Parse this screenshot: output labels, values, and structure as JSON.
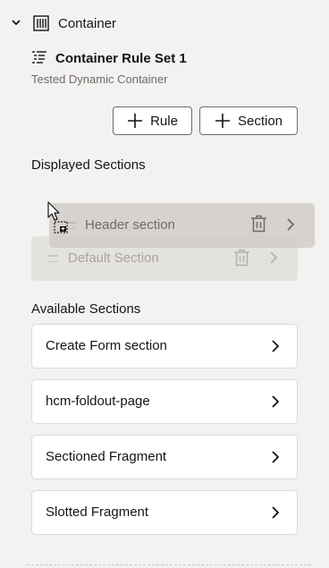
{
  "container": {
    "title": "Container"
  },
  "rule_set": {
    "title": "Container Rule Set 1",
    "subtitle": "Tested Dynamic Container"
  },
  "buttons": {
    "rule": "Rule",
    "section": "Section"
  },
  "displayed": {
    "label": "Displayed Sections",
    "dragging_item": "Header section",
    "items": [
      "Default Section"
    ]
  },
  "available": {
    "label": "Available Sections",
    "items": [
      "Create Form section",
      "hcm-foldout-page",
      "Sectioned Fragment",
      "Slotted Fragment"
    ]
  },
  "icons": {
    "collapse": "chevron-down-icon",
    "container": "container-columns-icon",
    "rule_set": "rule-set-list-icon",
    "add": "plus-icon",
    "drag": "drag-handle-icon",
    "delete": "trash-icon",
    "navigate": "chevron-right-icon",
    "cursor": "drag-cursor-icon"
  }
}
